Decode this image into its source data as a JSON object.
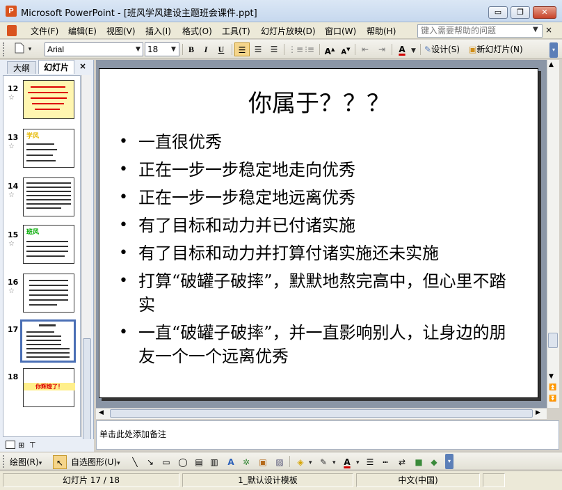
{
  "window": {
    "title": "Microsoft PowerPoint - [班风学风建设主题班会课件.ppt]",
    "app_icon": "P",
    "min": "▭",
    "max": "❐",
    "close": "✕"
  },
  "menu": {
    "items": [
      "文件(F)",
      "编辑(E)",
      "视图(V)",
      "插入(I)",
      "格式(O)",
      "工具(T)",
      "幻灯片放映(D)",
      "窗口(W)",
      "帮助(H)"
    ],
    "help_placeholder": "键入需要帮助的问题",
    "close": "×"
  },
  "toolbar": {
    "font": "Arial",
    "size": "18",
    "bold": "B",
    "italic": "I",
    "underline": "U",
    "design": "设计(S)",
    "new_slide": "新幻灯片(N)"
  },
  "panel": {
    "tab_outline": "大纲",
    "tab_slides": "幻灯片",
    "close": "×",
    "slides": [
      {
        "num": "12"
      },
      {
        "num": "13",
        "label": "学风"
      },
      {
        "num": "14"
      },
      {
        "num": "15",
        "label": "班风"
      },
      {
        "num": "16"
      },
      {
        "num": "17"
      },
      {
        "num": "18",
        "label": "你辉煌了！"
      }
    ]
  },
  "slide": {
    "title": "你属于？？？",
    "bullets": [
      "一直很优秀",
      "正在一步一步稳定地走向优秀",
      "正在一步一步稳定地远离优秀",
      "有了目标和动力并已付诸实施",
      "有了目标和动力并打算付诸实施还未实施",
      "打算“破罐子破摔”，默默地熬完高中，但心里不踏实",
      "一直“破罐子破摔”，并一直影响别人，让身边的朋友一个一个远离优秀"
    ]
  },
  "notes": {
    "placeholder": "单击此处添加备注"
  },
  "drawbar": {
    "draw": "绘图(R)",
    "autoshapes": "自选图形(U)"
  },
  "status": {
    "slide": "幻灯片 17 / 18",
    "template": "1_默认设计模板",
    "language": "中文(中国)"
  }
}
